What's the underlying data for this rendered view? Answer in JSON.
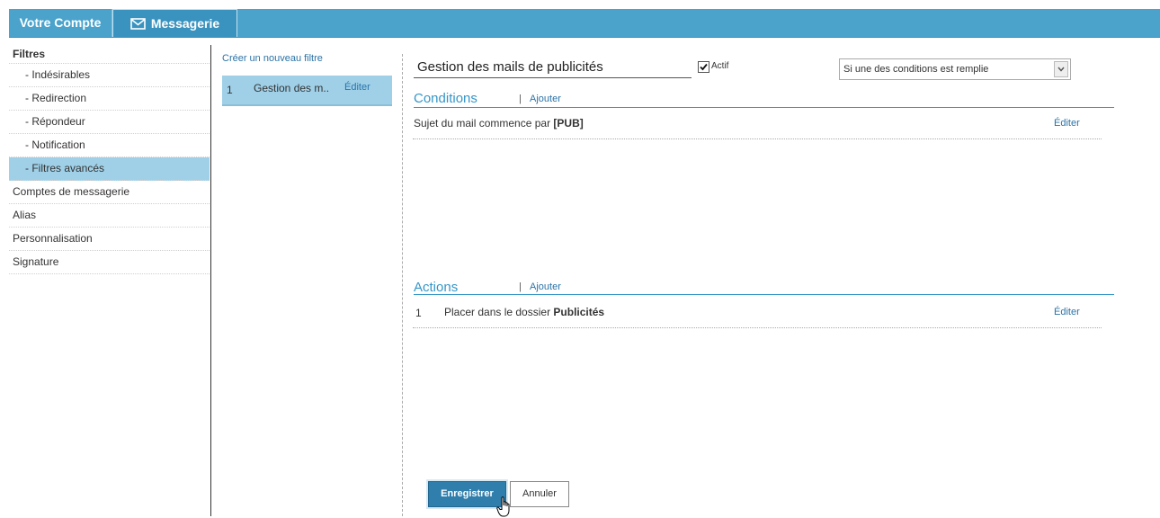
{
  "topbar": {
    "tab_account": "Votre Compte",
    "tab_mail": "Messagerie",
    "mail_icon": "envelope-icon"
  },
  "sidebar": {
    "title": "Filtres",
    "sub_items": [
      "- Indésirables",
      "- Redirection",
      "- Répondeur",
      "- Notification",
      "- Filtres avancés"
    ],
    "items": [
      "Comptes de messagerie",
      "Alias",
      "Personnalisation",
      "Signature"
    ],
    "active": "- Filtres avancés"
  },
  "filters": {
    "new_filter_label": "Créer un nouveau filtre",
    "list": [
      {
        "num": "1",
        "name": "Gestion des m..",
        "edit": "Éditer"
      }
    ]
  },
  "editor": {
    "filter_name": "Gestion des mails de publicités",
    "active_label": "Actif",
    "active_checked": true,
    "match_select": "Si une des conditions est remplie",
    "conditions": {
      "title": "Conditions",
      "separator": "|",
      "add": "Ajouter",
      "rows": [
        {
          "text": "Sujet du mail commence par ",
          "bold": "[PUB]",
          "edit": "Éditer"
        }
      ]
    },
    "actions": {
      "title": "Actions",
      "separator": "|",
      "add": "Ajouter",
      "rows": [
        {
          "num": "1",
          "text": "Placer dans le dossier ",
          "bold": "Publicités",
          "edit": "Éditer"
        }
      ]
    },
    "save_label": "Enregistrer",
    "cancel_label": "Annuler"
  },
  "colors": {
    "topbar": "#4ba3cc",
    "active_bg": "#9fd0e8",
    "accent": "#3596c8",
    "button": "#2f7eab"
  }
}
